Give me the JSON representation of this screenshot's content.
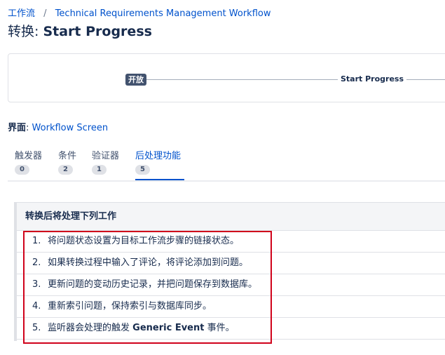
{
  "breadcrumb": {
    "workflows": "工作流",
    "separator": "/",
    "workflow_name": "Technical Requirements Management Workflow"
  },
  "title": {
    "prefix": "转换:",
    "name": "Start Progress"
  },
  "diagram": {
    "from_status": "开放",
    "transition": "Start Progress"
  },
  "screen": {
    "label": "界面",
    "colon": ":",
    "value": "Workflow Screen"
  },
  "tabs": [
    {
      "label": "触发器",
      "count": "0"
    },
    {
      "label": "条件",
      "count": "2"
    },
    {
      "label": "验证器",
      "count": "1"
    },
    {
      "label": "后处理功能",
      "count": "5"
    }
  ],
  "post_functions": {
    "header": "转换后将处理下列工作",
    "items": [
      {
        "num": "1.",
        "text": "将问题状态设置为目标工作流步骤的链接状态。"
      },
      {
        "num": "2.",
        "text": "如果转换过程中输入了评论，将评论添加到问题。"
      },
      {
        "num": "3.",
        "text": "更新问题的变动历史记录，并把问题保存到数据库。"
      },
      {
        "num": "4.",
        "text": "重新索引问题，保持索引与数据库同步。"
      },
      {
        "num": "5.",
        "text_before": "监听器会处理的触发",
        "event_name": "Generic Event",
        "text_after": "事件。"
      }
    ]
  },
  "colors": {
    "link": "#0052cc",
    "highlight": "#d0021b",
    "lozenge": "#42526e"
  }
}
